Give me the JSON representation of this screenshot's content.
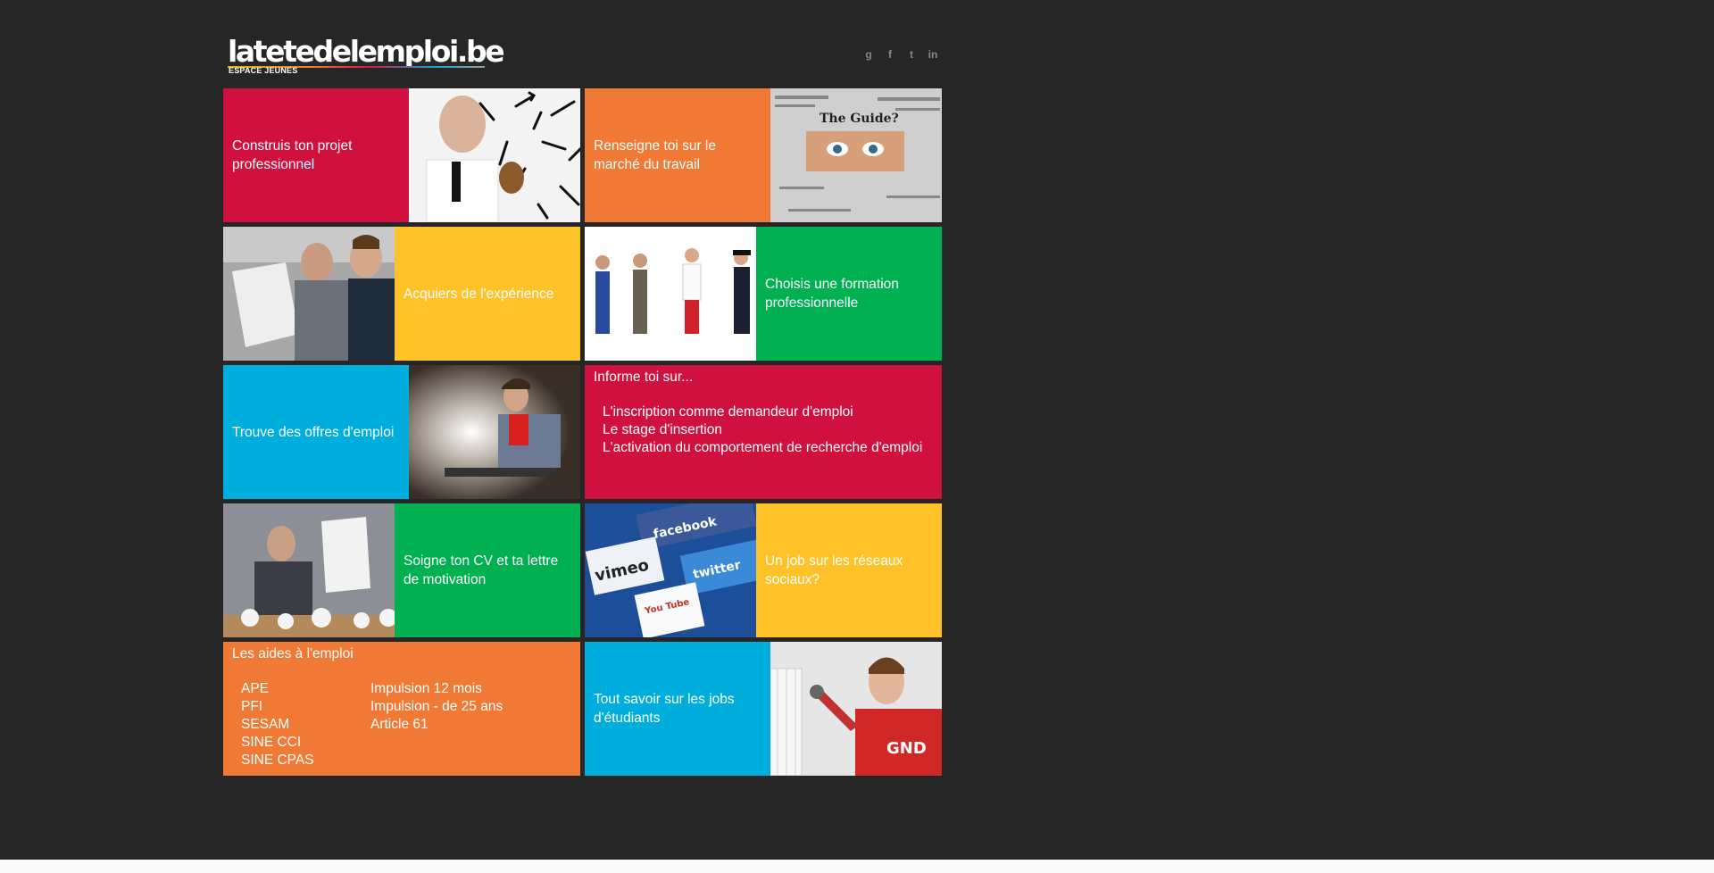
{
  "logo": {
    "title": "latetedelemploi.be",
    "subtitle": "ESPACE JEUNES"
  },
  "social": [
    {
      "name": "google-plus-icon",
      "glyph": "g"
    },
    {
      "name": "facebook-icon",
      "glyph": "f"
    },
    {
      "name": "twitter-icon",
      "glyph": "t"
    },
    {
      "name": "linkedin-icon",
      "glyph": "in"
    }
  ],
  "tiles": {
    "projet": "Construis ton projet professionnel",
    "marche": "Renseigne toi sur le marché du travail",
    "experience": "Acquiers de l'expérience",
    "formation": "Choisis une formation professionnelle",
    "offres": "Trouve des offres d'emploi",
    "informe": {
      "title": "Informe toi sur...",
      "items": [
        "L'inscription comme demandeur d'emploi",
        "Le stage d'insertion",
        "L'activation du comportement de recherche d'emploi"
      ]
    },
    "cv": "Soigne ton CV et ta lettre de motivation",
    "reseaux": "Un job sur les réseaux sociaux?",
    "aides": {
      "title": "Les aides à l'emploi",
      "col1": [
        "APE",
        "PFI",
        "SESAM",
        "SINE CCI",
        "SINE CPAS"
      ],
      "col2": [
        "Impulsion 12 mois",
        "Impulsion - de 25 ans",
        "Article 61"
      ]
    },
    "etudiants": "Tout savoir sur les jobs d'étudiants"
  },
  "photo_text": {
    "newspaper": "The Guide?",
    "facebook": "facebook",
    "vimeo": "vimeo",
    "twitter": "twitter",
    "youtube": "You Tube",
    "shirt": "GND"
  },
  "colors": {
    "red": "#d0103f",
    "orange": "#f07935",
    "yellow": "#ffc229",
    "green": "#01b050",
    "blue": "#00aede",
    "background": "#262626"
  }
}
